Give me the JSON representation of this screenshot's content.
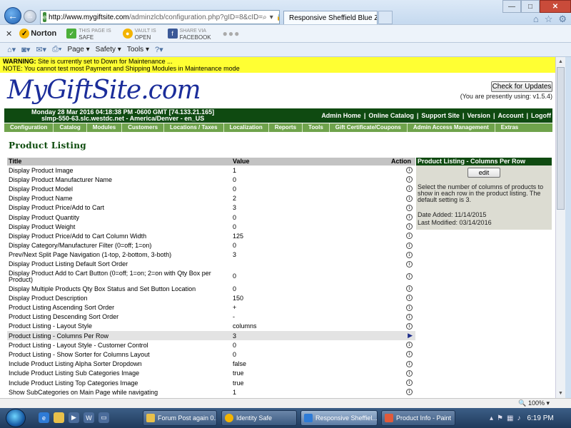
{
  "browser": {
    "url_host": "http://www.mygiftsite.com",
    "url_rest": "/adminzlcb/configuration.php?gID=8&cID=",
    "tab_title": "Responsive Sheffield Blue Z...",
    "norton": {
      "logo": "Norton",
      "safe_line1": "THIS PAGE IS",
      "safe_line2": "SAFE",
      "vault_line1": "VAULT IS",
      "vault_line2": "OPEN",
      "share_line1": "SHARE VIA",
      "share_line2": "FACEBOOK"
    },
    "commands": [
      "Page ▾",
      "Safety ▾",
      "Tools ▾"
    ],
    "zoom": "100%"
  },
  "warning": {
    "line1_label": "WARNING:",
    "line1_text": " Site is currently set to Down for Maintenance ...",
    "line2": "NOTE: You cannot test most Payment and Shipping Modules in Maintenance mode"
  },
  "header": {
    "logo": "MyGiftSite.com",
    "check_updates": "Check for Updates",
    "version": "(You are presently using: v1.5.4)",
    "server_line1": "Monday 28 Mar 2016 04:18:38 PM -0600 GMT [74.133.21.165]",
    "server_line2": "slmp-550-63.slc.westdc.net - America/Denver - en_US",
    "admin_links": [
      "Admin Home",
      "Online Catalog",
      "Support Site",
      "Version",
      "Account",
      "Logoff"
    ]
  },
  "nav": [
    "Configuration",
    "Catalog",
    "Modules",
    "Customers",
    "Locations / Taxes",
    "Localization",
    "Reports",
    "Tools",
    "Gift Certificate/Coupons",
    "Admin Access Management",
    "Extras"
  ],
  "page_title": "Product Listing",
  "table": {
    "col_title": "Title",
    "col_value": "Value",
    "col_action": "Action",
    "rows": [
      {
        "title": "Display Product Image",
        "value": "1"
      },
      {
        "title": "Display Product Manufacturer Name",
        "value": "0"
      },
      {
        "title": "Display Product Model",
        "value": "0"
      },
      {
        "title": "Display Product Name",
        "value": "2"
      },
      {
        "title": "Display Product Price/Add to Cart",
        "value": "3"
      },
      {
        "title": "Display Product Quantity",
        "value": "0"
      },
      {
        "title": "Display Product Weight",
        "value": "0"
      },
      {
        "title": "Display Product Price/Add to Cart Column Width",
        "value": "125"
      },
      {
        "title": "Display Category/Manufacturer Filter (0=off; 1=on)",
        "value": "0"
      },
      {
        "title": "Prev/Next Split Page Navigation (1-top, 2-bottom, 3-both)",
        "value": "3"
      },
      {
        "title": "Display Product Listing Default Sort Order",
        "value": ""
      },
      {
        "title": "Display Product Add to Cart Button (0=off; 1=on; 2=on with Qty Box per Product)",
        "value": "0"
      },
      {
        "title": "Display Multiple Products Qty Box Status and Set Button Location",
        "value": "0"
      },
      {
        "title": "Display Product Description",
        "value": "150"
      },
      {
        "title": "Product Listing Ascending Sort Order",
        "value": "+"
      },
      {
        "title": "Product Listing Descending Sort Order",
        "value": "-"
      },
      {
        "title": "Product Listing - Layout Style",
        "value": "columns"
      },
      {
        "title": "Product Listing - Columns Per Row",
        "value": "3"
      },
      {
        "title": "Product Listing - Layout Style - Customer Control",
        "value": "0"
      },
      {
        "title": "Product Listing - Show Sorter for Columns Layout",
        "value": "0"
      },
      {
        "title": "Include Product Listing Alpha Sorter Dropdown",
        "value": "false"
      },
      {
        "title": "Include Product Listing Sub Categories Image",
        "value": "true"
      },
      {
        "title": "Include Product Listing Top Categories Image",
        "value": "true"
      },
      {
        "title": "Show SubCategories on Main Page while navigating",
        "value": "1"
      }
    ]
  },
  "info_box": {
    "title": "Product Listing - Columns Per Row",
    "edit": "edit",
    "description": "Select the number of columns of products to show in each row in the product listing. The default setting is 3.",
    "date_added": "Date Added: 11/14/2015",
    "last_modified": "Last Modified: 03/14/2016"
  },
  "taskbar": {
    "buttons": [
      "Forum Post again 0...",
      "Identity Safe",
      "Responsive Sheffiel...",
      "Product Info - Paint"
    ],
    "clock": "6:19 PM"
  },
  "colors": {
    "admin_header": "#0f4a11",
    "nav_bar": "#6fa34c",
    "warning": "#ffff33",
    "logo": "#1b2d9a"
  }
}
